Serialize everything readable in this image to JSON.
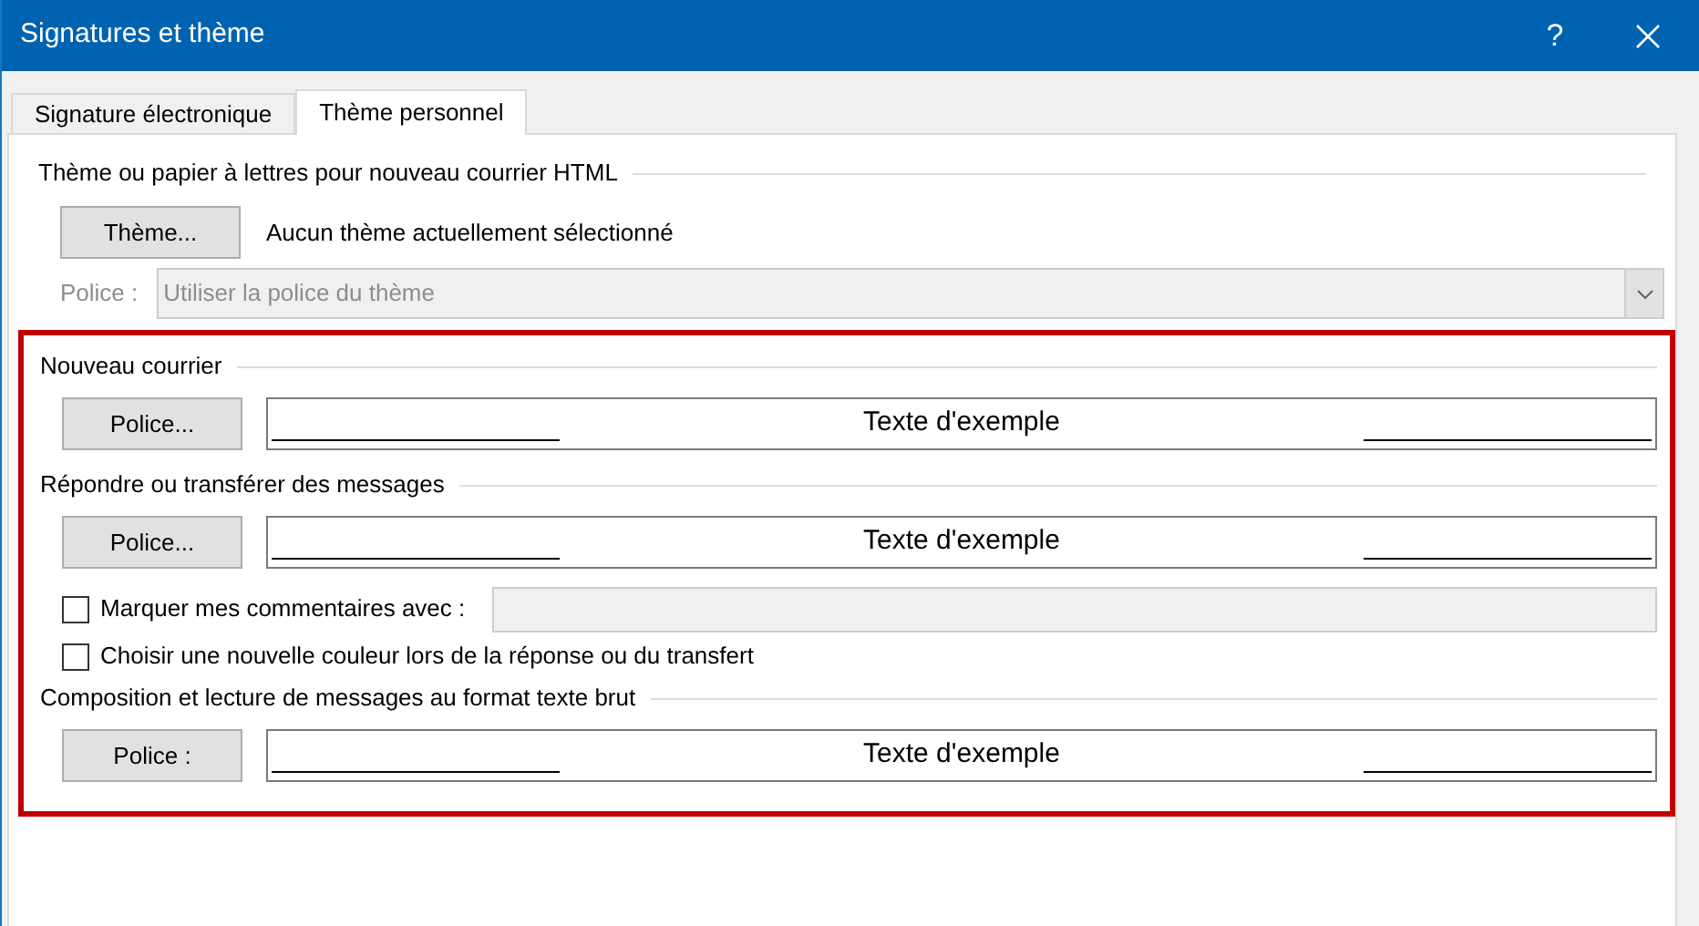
{
  "window": {
    "title": "Signatures et thème",
    "help": "?"
  },
  "tabs": [
    {
      "label": "Signature électronique",
      "selected": false
    },
    {
      "label": "Thème personnel",
      "selected": true
    }
  ],
  "theme_section": {
    "heading": "Thème ou papier à lettres pour nouveau courrier HTML",
    "button": {
      "label": "Thème..."
    },
    "status": "Aucun thème actuellement sélectionné",
    "font_label": "Police :",
    "font_select": {
      "value": "Utiliser la police du thème",
      "disabled": true
    }
  },
  "sections": [
    {
      "heading": "Nouveau courrier",
      "button": {
        "label": "Police..."
      },
      "sample": "Texte d'exemple"
    },
    {
      "heading": "Répondre ou transférer des messages",
      "button": {
        "label": "Police..."
      },
      "sample": "Texte d'exemple",
      "options": [
        {
          "kind": "with_field",
          "label": "Marquer mes commentaires avec :",
          "checked": false
        },
        {
          "kind": "plain",
          "label": "Choisir une nouvelle couleur lors de la réponse ou du transfert",
          "checked": false
        }
      ]
    },
    {
      "heading": "Composition et lecture de messages au format texte brut",
      "button": {
        "label": "Police :"
      },
      "sample": "Texte d'exemple"
    }
  ]
}
